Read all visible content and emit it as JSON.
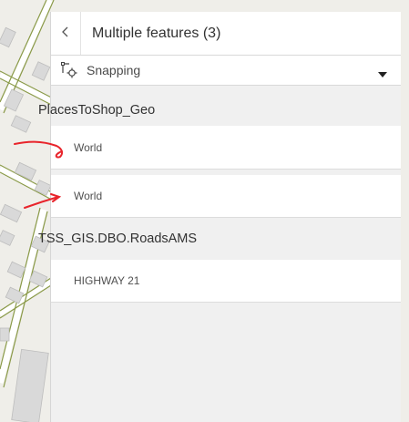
{
  "panel": {
    "title": "Multiple features (3)",
    "back_icon": "chevron-left-icon",
    "snapping": {
      "icon": "snapping-icon",
      "label": "Snapping",
      "caret_icon": "caret-down-icon"
    },
    "groups": [
      {
        "layer": "PlacesToShop_Geo",
        "features": [
          "World",
          "World"
        ]
      },
      {
        "layer": "TSS_GIS.DBO.RoadsAMS",
        "features": [
          "HIGHWAY 21"
        ]
      }
    ]
  },
  "colors": {
    "annotation_arrow": "#e8242b",
    "panel_bg": "#f0f0f0",
    "map_bg": "#efeee9",
    "building": "#d9d9d9",
    "road_casing": "#7a8a3c"
  }
}
